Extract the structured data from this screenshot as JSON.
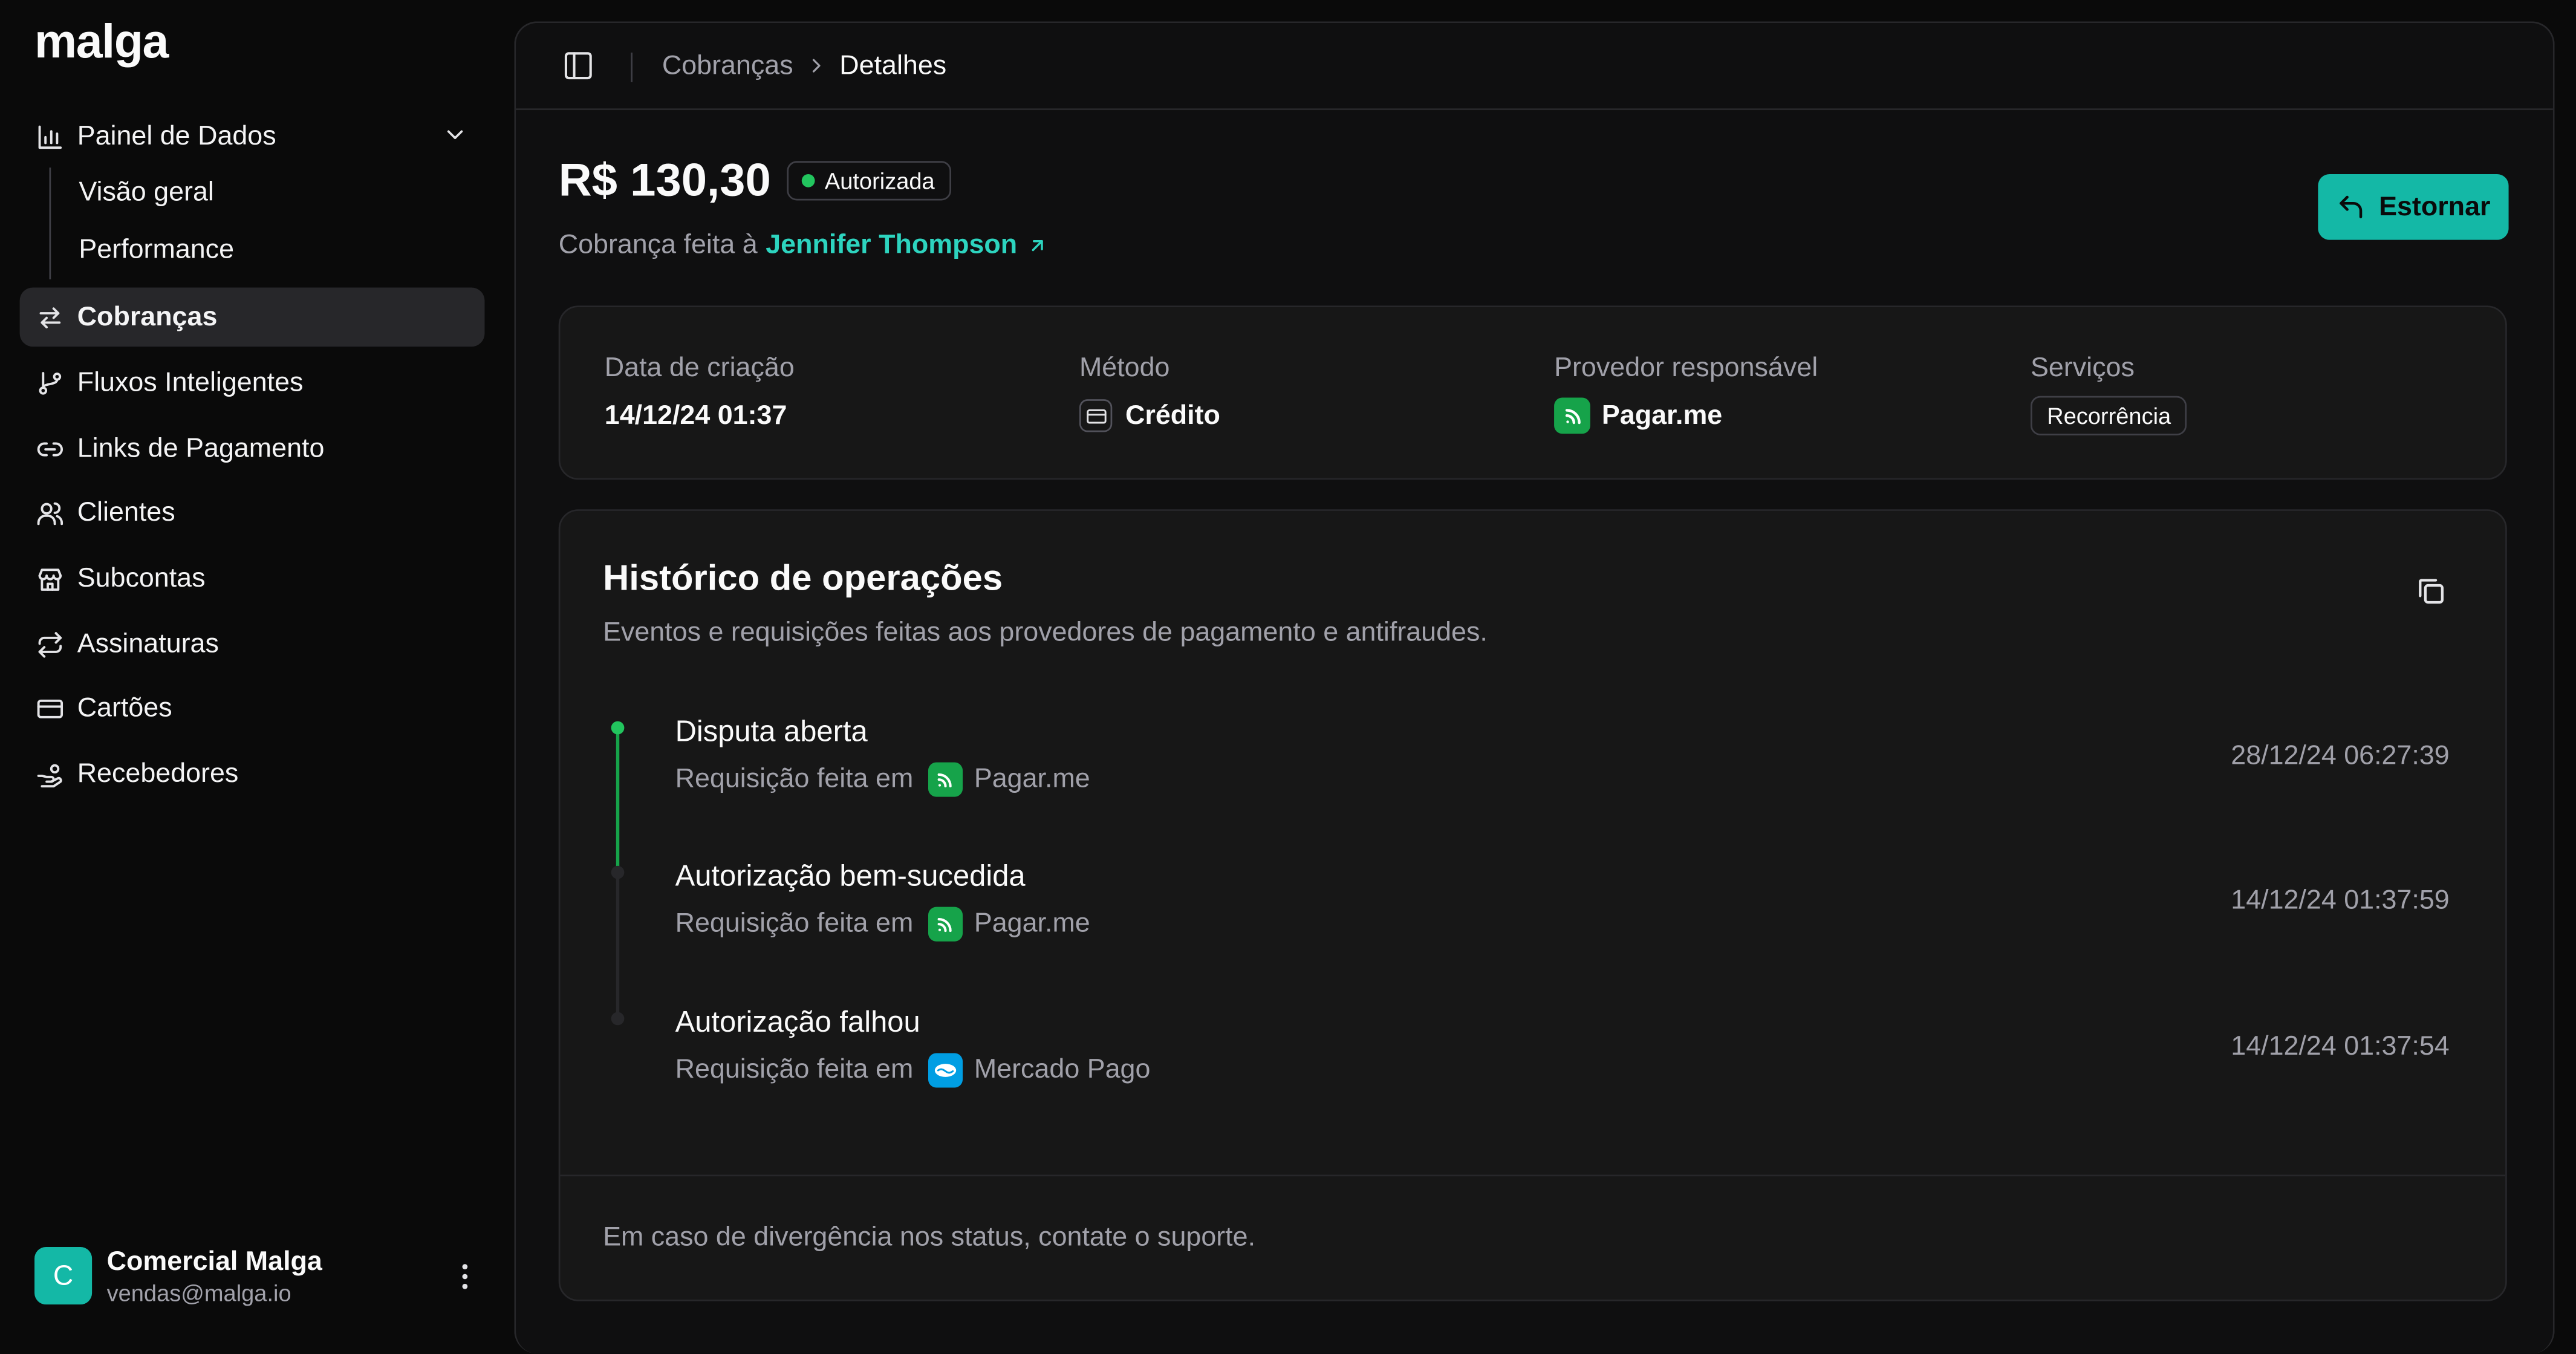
{
  "app": {
    "logo": "malga"
  },
  "sidebar": {
    "group": {
      "label": "Painel de Dados",
      "children": [
        {
          "label": "Visão geral"
        },
        {
          "label": "Performance"
        }
      ]
    },
    "items": [
      {
        "label": "Cobranças",
        "icon": "arrows-exchange-icon",
        "active": true
      },
      {
        "label": "Fluxos Inteligentes",
        "icon": "git-branch-icon"
      },
      {
        "label": "Links de Pagamento",
        "icon": "link-icon"
      },
      {
        "label": "Clientes",
        "icon": "users-icon"
      },
      {
        "label": "Subcontas",
        "icon": "store-icon"
      },
      {
        "label": "Assinaturas",
        "icon": "repeat-icon"
      },
      {
        "label": "Cartões",
        "icon": "credit-card-icon"
      },
      {
        "label": "Recebedores",
        "icon": "hand-coins-icon"
      }
    ],
    "user": {
      "initial": "C",
      "name": "Comercial Malga",
      "email": "vendas@malga.io"
    }
  },
  "breadcrumb": {
    "parent": "Cobranças",
    "current": "Detalhes"
  },
  "charge": {
    "amount": "R$ 130,30",
    "status": "Autorizada",
    "status_color": "#22c55e",
    "made_to_prefix": "Cobrança feita à",
    "customer": "Jennifer Thompson",
    "refund_label": "Estornar"
  },
  "details": {
    "created": {
      "label": "Data de criação",
      "value": "14/12/24 01:37"
    },
    "method": {
      "label": "Método",
      "value": "Crédito"
    },
    "provider": {
      "label": "Provedor responsável",
      "value": "Pagar.me"
    },
    "services": {
      "label": "Serviços",
      "value": "Recorrência"
    }
  },
  "history": {
    "title": "Histórico de operações",
    "subtitle": "Eventos e requisições feitas aos provedores de pagamento e antifraudes.",
    "req_prefix": "Requisição feita em",
    "events": [
      {
        "title": "Disputa aberta",
        "provider": "Pagar.me",
        "time": "28/12/24 06:27:39"
      },
      {
        "title": "Autorização bem-sucedida",
        "provider": "Pagar.me",
        "time": "14/12/24 01:37:59"
      },
      {
        "title": "Autorização falhou",
        "provider": "Mercado Pago",
        "time": "14/12/24 01:37:54"
      }
    ],
    "footer": "Em caso de divergência nos status, contate o suporte."
  },
  "colors": {
    "accent": "#14b8a6",
    "link": "#2dd4bf",
    "pagarme": "#16a34a",
    "mercadopago": "#009ee3"
  }
}
